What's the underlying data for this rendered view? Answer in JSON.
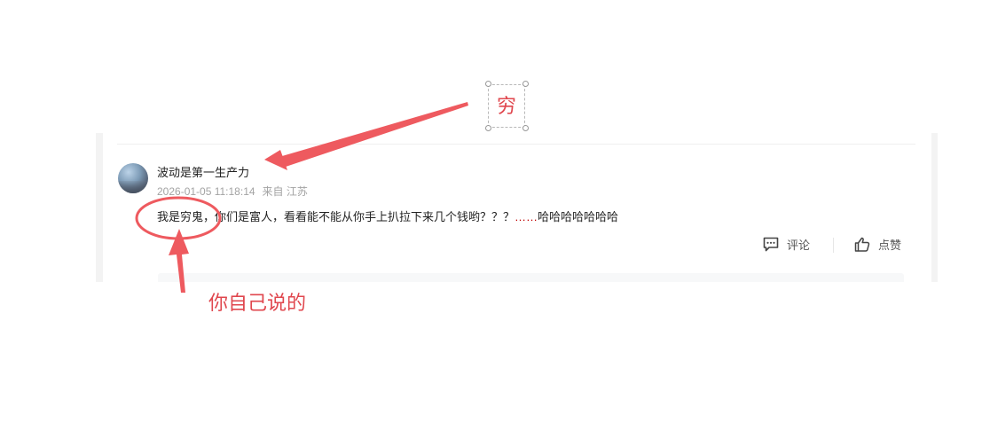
{
  "comment": {
    "username": "波动是第一生产力",
    "timestamp": "2026-01-05 11:18:14",
    "location_prefix": "来自",
    "location": "江苏",
    "text_main": "我是穷鬼，你们是富人，看看能不能从你手上扒拉下来几个钱哟？？？",
    "text_ellipsis": "……",
    "text_end": "哈哈哈哈哈哈哈"
  },
  "actions": {
    "comment_label": "评论",
    "comment_icon": "comment-icon",
    "like_label": "点赞",
    "like_icon": "thumbs-up-icon"
  },
  "annotations": {
    "box_text": "穷",
    "note_text": "你自己说的",
    "color": "#e0474e"
  }
}
